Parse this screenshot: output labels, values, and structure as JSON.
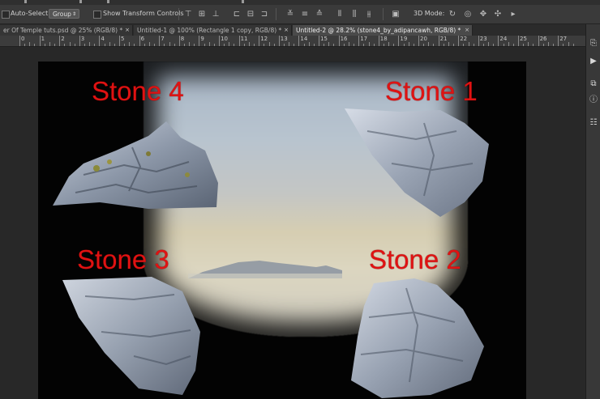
{
  "options_bar": {
    "auto_select_label": "Auto-Select:",
    "auto_select_value": "Group",
    "transform_controls_label": "Show Transform Controls",
    "mode_label": "3D Mode:"
  },
  "tabs": [
    {
      "label": "er Of Temple tuts.psd @ 25% (RGB/8) *",
      "active": false
    },
    {
      "label": "Untitled-1 @ 100% (Rectangle 1 copy, RGB/8) *",
      "active": false
    },
    {
      "label": "Untitled-2 @ 28.2% (stone4_by_adipancawh, RGB/8) *",
      "active": true
    }
  ],
  "tab_close_glyph": "×",
  "ruler_ticks": [
    "0",
    "1",
    "2",
    "3",
    "4",
    "5",
    "6",
    "7",
    "8",
    "9",
    "10",
    "11",
    "12",
    "13",
    "14",
    "15",
    "16",
    "17",
    "18",
    "19",
    "20",
    "21",
    "22",
    "23",
    "24",
    "25",
    "26",
    "27"
  ],
  "canvas": {
    "stones": [
      {
        "label": "Stone 4",
        "icon": "stone-rock"
      },
      {
        "label": "Stone 1",
        "icon": "stone-rock"
      },
      {
        "label": "Stone 3",
        "icon": "stone-rock"
      },
      {
        "label": "Stone 2",
        "icon": "stone-rock"
      }
    ],
    "colors": {
      "label": "#e01212",
      "background": "#030303"
    }
  },
  "panel_icons": [
    "adjust-icon",
    "play-icon",
    "link-icon",
    "info-icon",
    "properties-icon"
  ]
}
